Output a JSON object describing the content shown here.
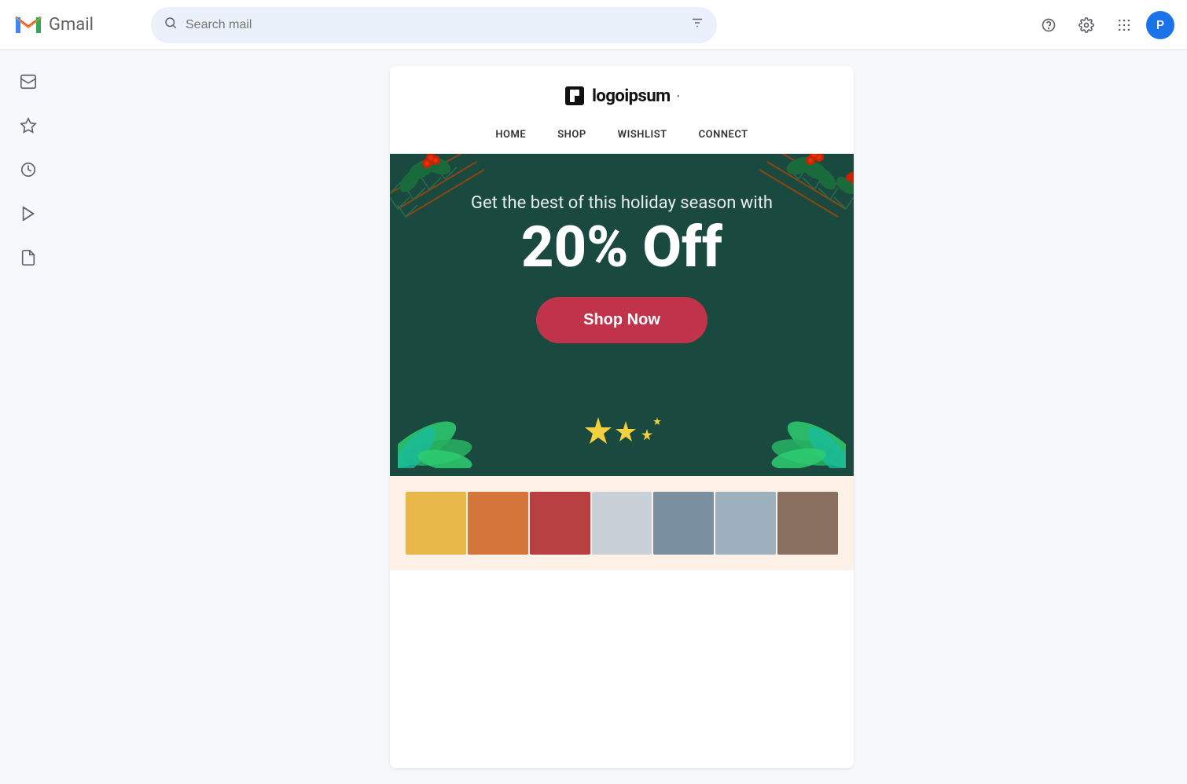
{
  "topbar": {
    "logo_text": "Gmail",
    "search_placeholder": "Search mail",
    "avatar_letter": "P",
    "avatar_bg": "#1a73e8"
  },
  "sidebar": {
    "icons": [
      {
        "name": "inbox-icon",
        "symbol": "⬜"
      },
      {
        "name": "star-icon",
        "symbol": "☆"
      },
      {
        "name": "clock-icon",
        "symbol": "🕐"
      },
      {
        "name": "send-icon",
        "symbol": "▷"
      },
      {
        "name": "draft-icon",
        "symbol": "📄"
      }
    ]
  },
  "email": {
    "logo": {
      "text": "logoipsum",
      "dot": "·"
    },
    "nav": {
      "links": [
        "HOME",
        "SHOP",
        "WISHLIST",
        "CONNECT"
      ]
    },
    "hero": {
      "sub_text": "Get the best of this holiday season with",
      "discount": "20% Off",
      "cta_label": "Shop Now",
      "bg_color": "#1a4a3f",
      "cta_bg": "#c1334a"
    },
    "product_colors": [
      "#f5c842",
      "#e07b39",
      "#c94f3a",
      "#b8c5cd",
      "#7b8fa0",
      "#a0b0ba"
    ]
  }
}
